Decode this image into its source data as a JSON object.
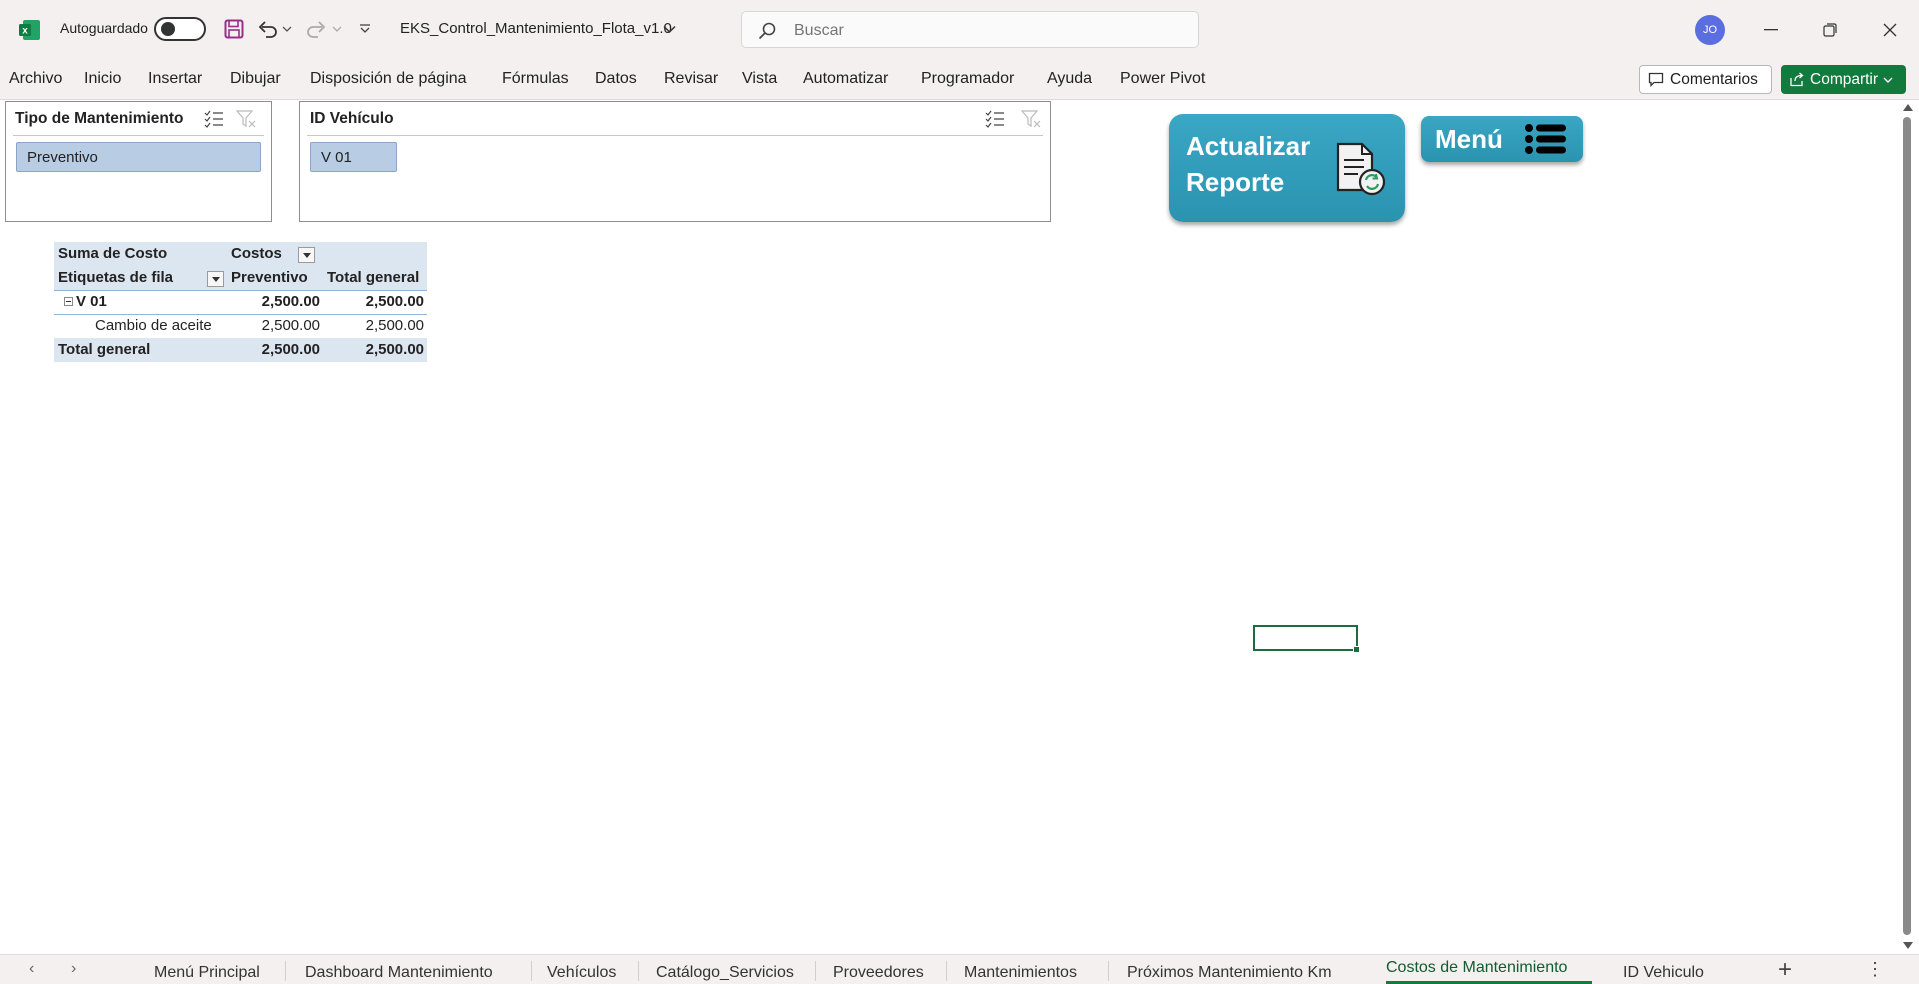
{
  "titlebar": {
    "autosave_label": "Autoguardado",
    "autosave_on": false,
    "doc_title": "EKS_Control_Mantenimiento_Flota_v1.0",
    "search_placeholder": "Buscar",
    "avatar_initials": "JO"
  },
  "ribbon": {
    "tabs": [
      "Archivo",
      "Inicio",
      "Insertar",
      "Dibujar",
      "Disposición de página",
      "Fórmulas",
      "Datos",
      "Revisar",
      "Vista",
      "Automatizar",
      "Programador",
      "Ayuda",
      "Power Pivot"
    ],
    "comments_label": "Comentarios",
    "share_label": "Compartir"
  },
  "slicers": {
    "tipo": {
      "title": "Tipo de Mantenimiento",
      "item": "Preventivo"
    },
    "vehiculo": {
      "title": "ID Vehículo",
      "item": "V 01"
    }
  },
  "buttons": {
    "actualizar_line1": "Actualizar",
    "actualizar_line2": "Reporte",
    "menu": "Menú"
  },
  "pivot": {
    "value_field": "Suma de Costo",
    "column_field": "Costos",
    "row_labels_header": "Etiquetas de fila",
    "col_header_1": "Preventivo",
    "col_header_2": "Total general",
    "group_label": "V 01",
    "group_value_1": "2,500.00",
    "group_value_2": "2,500.00",
    "item_label": "Cambio de aceite",
    "item_value_1": "2,500.00",
    "item_value_2": "2,500.00",
    "total_label": "Total general",
    "total_value_1": "2,500.00",
    "total_value_2": "2,500.00"
  },
  "sheet_tabs": {
    "tabs": [
      "Menú Principal",
      "Dashboard Mantenimiento",
      "Vehículos",
      "Catálogo_Servicios",
      "Proveedores",
      "Mantenimientos",
      "Próximos Mantenimiento Km",
      "Costos de Mantenimiento",
      "ID Vehiculo"
    ],
    "active": "Costos de Mantenimiento"
  },
  "colors": {
    "excel_green": "#107c41",
    "slicer_selected": "#b8cce4",
    "pivot_header": "#dce6f1",
    "button_teal": "#2a93b0"
  }
}
